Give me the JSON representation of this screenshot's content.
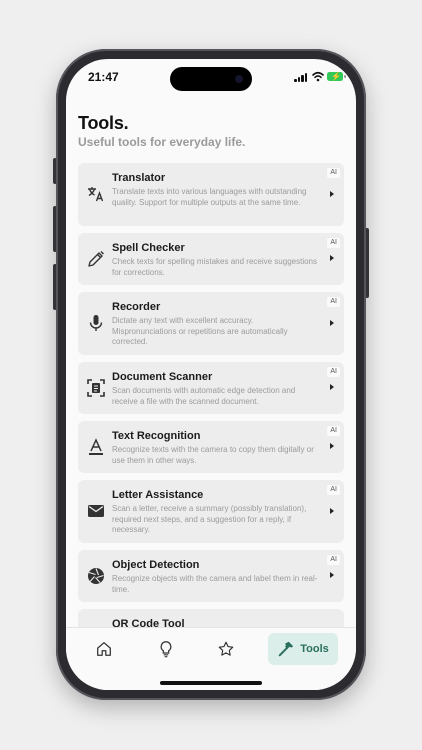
{
  "status": {
    "time": "21:47"
  },
  "header": {
    "title": "Tools.",
    "subtitle": "Useful tools for everyday life."
  },
  "tools": [
    {
      "title": "Translator",
      "description": "Translate texts into various languages with outstanding quality. Support for multiple outputs at the same time.",
      "badge": "AI",
      "icon": "translate-icon"
    },
    {
      "title": "Spell Checker",
      "description": "Check texts for spelling mistakes and receive suggestions for corrections.",
      "badge": "AI",
      "icon": "pen-icon"
    },
    {
      "title": "Recorder",
      "description": "Dictate any text with excellent accuracy. Mispronunciations or repetitions are automatically corrected.",
      "badge": "AI",
      "icon": "microphone-icon"
    },
    {
      "title": "Document Scanner",
      "description": "Scan documents with automatic edge detection and receive a file with the scanned document.",
      "badge": "AI",
      "icon": "document-scan-icon"
    },
    {
      "title": "Text Recognition",
      "description": "Recognize texts with the camera to copy them digitally or use them in other ways.",
      "badge": "AI",
      "icon": "text-format-icon"
    },
    {
      "title": "Letter Assistance",
      "description": "Scan a letter, receive a summary (possibly translation), required next steps, and a suggestion for a reply, if necessary.",
      "badge": "AI",
      "icon": "mail-icon"
    },
    {
      "title": "Object Detection",
      "description": "Recognize objects with the camera and label them in real-time.",
      "badge": "AI",
      "icon": "camera-aperture-icon"
    },
    {
      "title": "QR Code Tool",
      "description": "",
      "badge": "",
      "icon": "qr-code-icon"
    }
  ],
  "tabbar": {
    "items": [
      {
        "icon": "home-icon"
      },
      {
        "icon": "lightbulb-icon"
      },
      {
        "icon": "star-icon"
      },
      {
        "icon": "hammer-icon",
        "label": "Tools",
        "active": true
      }
    ]
  },
  "colors": {
    "accent": "#2a6f5e",
    "active_tab_bg": "#dceee9",
    "card_bg": "#ededed"
  }
}
